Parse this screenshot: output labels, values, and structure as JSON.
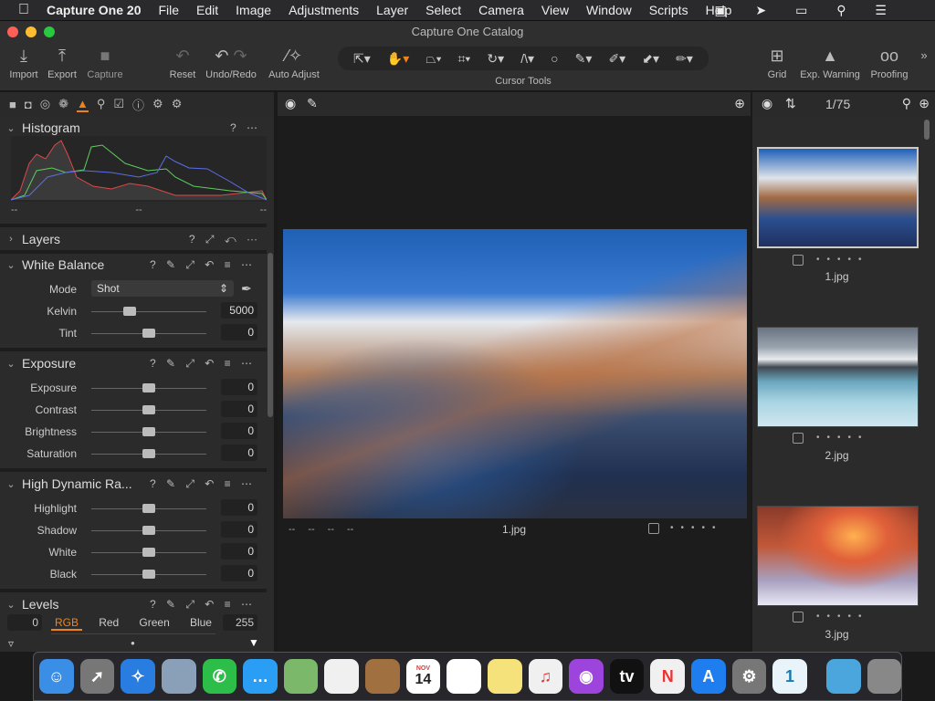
{
  "menubar": {
    "app": "Capture One 20",
    "items": [
      "File",
      "Edit",
      "Image",
      "Adjustments",
      "Layer",
      "Select",
      "Camera",
      "View",
      "Window",
      "Scripts",
      "Help"
    ]
  },
  "window": {
    "title": "Capture One Catalog"
  },
  "toolbar": {
    "import": "Import",
    "export": "Export",
    "capture": "Capture",
    "reset": "Reset",
    "undo_redo": "Undo/Redo",
    "auto_adjust": "Auto Adjust",
    "cursor_tools": "Cursor Tools",
    "grid": "Grid",
    "exp_warning": "Exp. Warning",
    "proofing": "Proofing"
  },
  "histogram": {
    "title": "Histogram",
    "labels": [
      "--",
      "--",
      "--"
    ]
  },
  "layers": {
    "title": "Layers"
  },
  "white_balance": {
    "title": "White Balance",
    "mode_label": "Mode",
    "mode_value": "Shot",
    "rows": [
      {
        "label": "Kelvin",
        "value": "5000",
        "pos": 0.33
      },
      {
        "label": "Tint",
        "value": "0",
        "pos": 0.5
      }
    ]
  },
  "exposure": {
    "title": "Exposure",
    "rows": [
      {
        "label": "Exposure",
        "value": "0",
        "pos": 0.5
      },
      {
        "label": "Contrast",
        "value": "0",
        "pos": 0.5
      },
      {
        "label": "Brightness",
        "value": "0",
        "pos": 0.5
      },
      {
        "label": "Saturation",
        "value": "0",
        "pos": 0.5
      }
    ]
  },
  "hdr": {
    "title": "High Dynamic Ra...",
    "rows": [
      {
        "label": "Highlight",
        "value": "0",
        "pos": 0.5
      },
      {
        "label": "Shadow",
        "value": "0",
        "pos": 0.5
      },
      {
        "label": "White",
        "value": "0",
        "pos": 0.5
      },
      {
        "label": "Black",
        "value": "0",
        "pos": 0.5
      }
    ]
  },
  "levels": {
    "title": "Levels",
    "low": "0",
    "high": "255",
    "tabs": [
      "RGB",
      "Red",
      "Green",
      "Blue"
    ],
    "active_tab": "RGB"
  },
  "viewer": {
    "meta": [
      "--",
      "--",
      "--",
      "--"
    ],
    "filename": "1.jpg"
  },
  "browser": {
    "counter": "1/75",
    "thumbs": [
      {
        "name": "1.jpg",
        "selected": true
      },
      {
        "name": "2.jpg"
      },
      {
        "name": "3.jpg"
      }
    ]
  },
  "colors": {
    "accent": "#f0821e",
    "bg": "#2b2b2b"
  },
  "dock": [
    "finder",
    "launchpad",
    "safari",
    "mail",
    "facetime",
    "messages",
    "maps",
    "photos",
    "contacts",
    "calendar",
    "reminders",
    "notes",
    "music",
    "podcasts",
    "tv",
    "news",
    "app-store",
    "system-preferences",
    "1password",
    "downloads-folder",
    "trash"
  ],
  "calendar": {
    "month": "NOV",
    "day": "14"
  }
}
